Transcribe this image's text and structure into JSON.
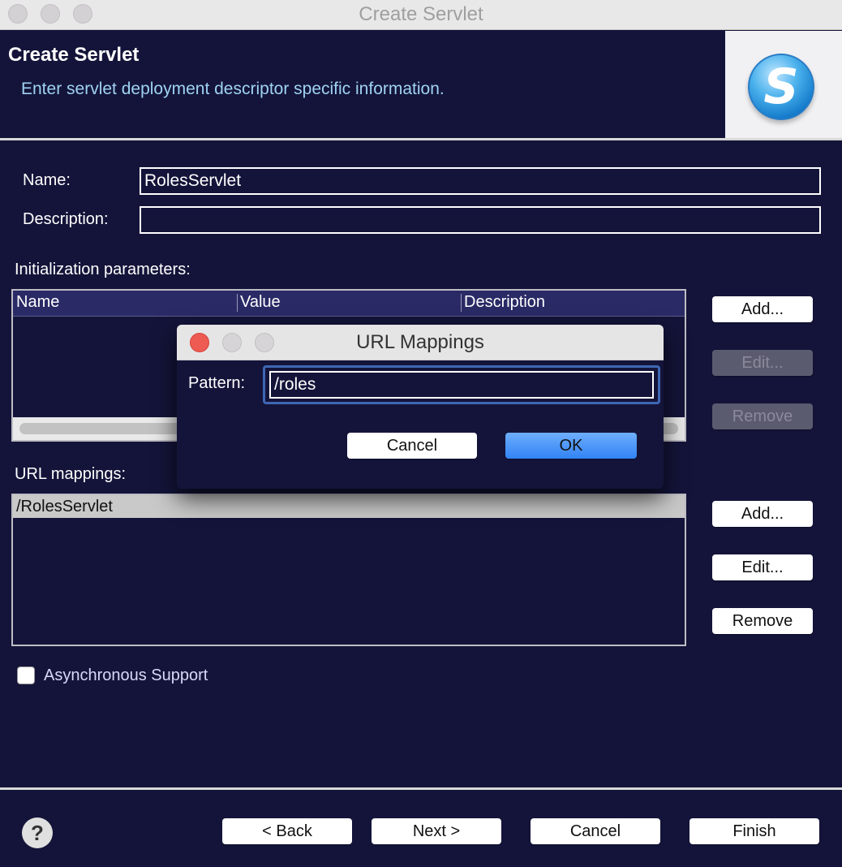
{
  "window": {
    "title": "Create Servlet"
  },
  "header": {
    "title": "Create Servlet",
    "subtitle": "Enter servlet deployment descriptor specific information.",
    "logo_letter": "S"
  },
  "form": {
    "name_label": "Name:",
    "name_value": "RolesServlet",
    "description_label": "Description:",
    "description_value": ""
  },
  "init_params": {
    "section_label": "Initialization parameters:",
    "columns": [
      "Name",
      "Value",
      "Description"
    ],
    "rows": [],
    "buttons": {
      "add": "Add...",
      "edit": "Edit...",
      "remove": "Remove"
    }
  },
  "url_mappings": {
    "section_label": "URL mappings:",
    "items": [
      "/RolesServlet"
    ],
    "selected_index": 0,
    "buttons": {
      "add": "Add...",
      "edit": "Edit...",
      "remove": "Remove"
    }
  },
  "async": {
    "label": "Asynchronous Support",
    "checked": false
  },
  "footer": {
    "help_glyph": "?",
    "back": "< Back",
    "next": "Next >",
    "cancel": "Cancel",
    "finish": "Finish"
  },
  "dialog": {
    "title": "URL Mappings",
    "pattern_label": "Pattern:",
    "pattern_value": "/roles",
    "cancel": "Cancel",
    "ok": "OK"
  },
  "colors": {
    "background": "#14143a",
    "subtitle": "#9fd2f2",
    "primary_button": "#3283f6",
    "close_button": "#ee5b52"
  }
}
